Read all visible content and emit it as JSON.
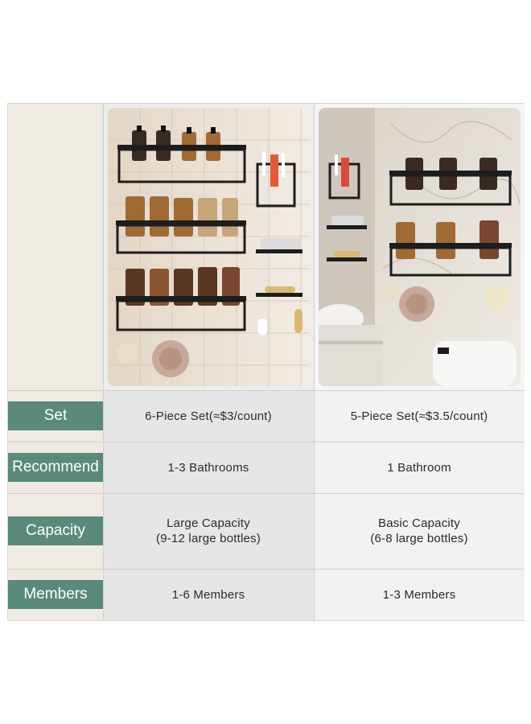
{
  "rows": [
    {
      "label": "Set",
      "a": "6-Piece Set(≈$3/count)",
      "b": "5-Piece Set(≈$3.5/count)"
    },
    {
      "label": "Recommend",
      "a": "1-3 Bathrooms",
      "b": "1 Bathroom"
    },
    {
      "label": "Capacity",
      "a_line1": "Large Capacity",
      "a_line2": "(9-12 large bottles)",
      "b_line1": "Basic Capacity",
      "b_line2": "(6-8 large bottles)"
    },
    {
      "label": "Members",
      "a": "1-6 Members",
      "b": "1-3 Members"
    }
  ],
  "colors": {
    "tag": "#5b8a7b",
    "label_bg": "#efeae3",
    "col_a_bg": "#e6e6e6",
    "col_b_bg": "#f2f2f2"
  },
  "images": [
    {
      "name": "six-piece-shelf-photo"
    },
    {
      "name": "five-piece-shelf-photo"
    }
  ]
}
